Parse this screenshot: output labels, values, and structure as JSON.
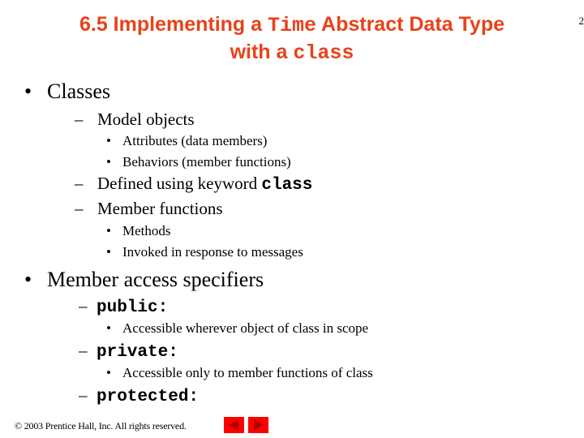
{
  "slide": {
    "title": {
      "line1_pre": "6.5 Implementing a ",
      "line1_code": "Time",
      "line1_post": " Abstract Data Type",
      "line2_pre": "with a ",
      "line2_code": "class"
    },
    "page_number": "2",
    "bullets": {
      "classes": "Classes",
      "model_objects": "Model objects",
      "attributes": "Attributes (data members)",
      "behaviors": "Behaviors (member functions)",
      "defined_using_pre": "Defined using keyword ",
      "defined_using_code": "class",
      "member_functions": "Member functions",
      "methods": "Methods",
      "invoked": "Invoked in response to messages",
      "access_specifiers": "Member access specifiers",
      "public_code": "public:",
      "public_desc": "Accessible wherever object of class in scope",
      "private_code": "private:",
      "private_desc": "Accessible only to member functions of class",
      "protected_code": "protected:"
    },
    "markers": {
      "l1": "•",
      "l2_dash": "–",
      "l3": "•"
    }
  },
  "footer": {
    "copyright": "© 2003 Prentice Hall, Inc.  All rights reserved."
  },
  "nav": {
    "prev_icon": "triangle-left-icon",
    "next_icon": "triangle-right-icon",
    "button_color": "#ff0000",
    "arrow_color": "#b00000"
  },
  "colors": {
    "title": "#e8421a",
    "text": "#000000"
  }
}
